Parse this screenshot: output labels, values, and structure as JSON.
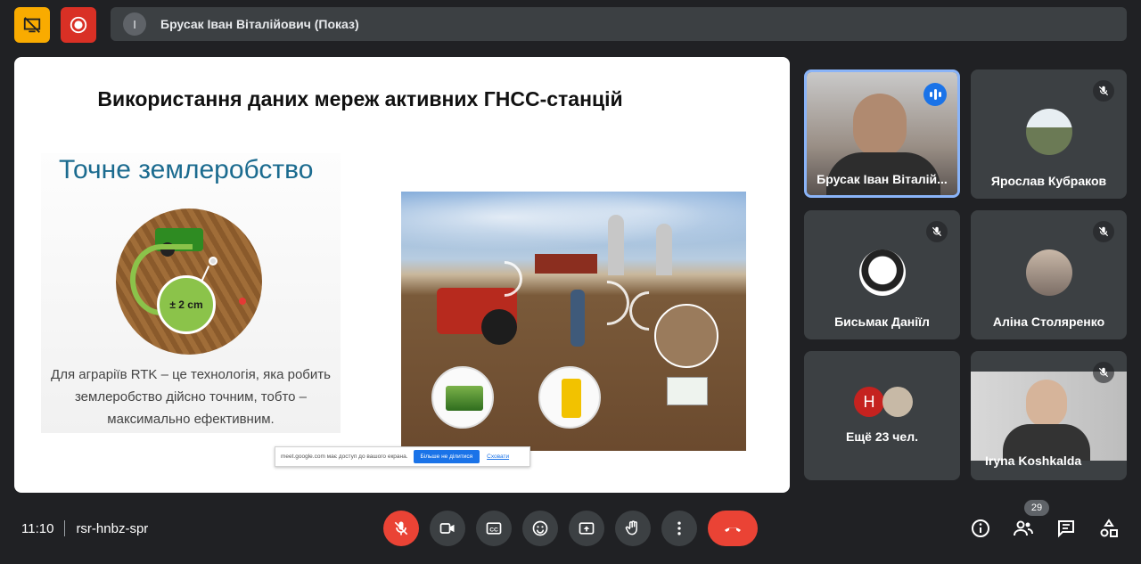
{
  "top_bar": {
    "presenter_initial": "I",
    "presenter_label": "Брусак Іван Віталійович (Показ)"
  },
  "slide": {
    "title": "Використання даних мереж активних ГНСС-станцій",
    "left_heading": "Точне землеробство",
    "accuracy_label": "± 2 cm",
    "description_lines": [
      "Для аграріїв RTK – це технологія, яка робить",
      "землеробство дійсно точним, тобто –",
      "максимально ефективним."
    ]
  },
  "share_bar": {
    "message": "meet.google.com має доступ до вашого екрана.",
    "stop_label": "Більше не ділитися",
    "hide_label": "Сховати"
  },
  "participants": [
    {
      "name": "Брусак Іван Віталій...",
      "speaking": true
    },
    {
      "name": "Ярослав Кубраков",
      "muted": true
    },
    {
      "name": "Бисьмак Даніїл",
      "muted": true
    },
    {
      "name": "Аліна Столяренко",
      "muted": true
    },
    {
      "name": "Iryna Koshkalda",
      "muted": true
    }
  ],
  "more_tile": {
    "initial": "H",
    "label": "Ещё 23 чел."
  },
  "bottom_bar": {
    "time": "11:10",
    "meeting_code": "rsr-hnbz-spr",
    "participant_count": "29"
  },
  "colors": {
    "accent_blue": "#1a73e8",
    "end_call_red": "#ea4335",
    "background": "#202124",
    "tile": "#3c4043",
    "warning_yellow": "#f9ab00"
  },
  "icons": {
    "top_left": "presentation-off-icon",
    "record": "record-icon",
    "mic": "mic-off-icon",
    "camera": "camera-icon",
    "captions": "captions-icon",
    "emoji": "emoji-icon",
    "present": "present-screen-icon",
    "hand": "raise-hand-icon",
    "more": "more-vert-icon",
    "end_call": "end-call-icon",
    "info": "info-icon",
    "people": "people-icon",
    "chat": "chat-icon",
    "activities": "activities-icon"
  }
}
